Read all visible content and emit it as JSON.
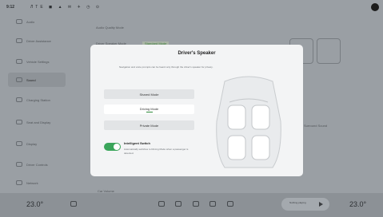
{
  "status_bar": {
    "time": "9:12",
    "icons_text": "ЛТЕ ◼ ▲ ✉ ✈ ◷ ⊙"
  },
  "sidebar": {
    "items": [
      {
        "label": "Audio",
        "active": false
      },
      {
        "label": "Driver Assistance",
        "active": false
      },
      {
        "label": "Vehicle Settings",
        "active": false
      },
      {
        "label": "Sound",
        "active": true
      },
      {
        "label": "Charging Station",
        "active": false
      },
      {
        "label": "Seat and Display",
        "active": false
      },
      {
        "label": "Display",
        "active": false
      },
      {
        "label": "Driver Controls",
        "active": false
      },
      {
        "label": "Network",
        "active": false
      }
    ]
  },
  "background": {
    "section_title": "Audio Quality Mode",
    "row_label": "Driver Speaker Mode",
    "row_tag": "Standard Mode",
    "side_label": "Surround Sound",
    "bottom_label": "Car Volume"
  },
  "modal": {
    "title": "Driver's Speaker",
    "subtitle": "Navigation and voice prompts can be heard only through the driver's speaker for privacy.",
    "modes": [
      {
        "label": "Shared Mode",
        "selected": false
      },
      {
        "label": "Driving Mode",
        "selected": true
      },
      {
        "label": "Private Mode",
        "selected": false
      }
    ],
    "smart_switch": {
      "title": "Intelligent Switch",
      "description": "Automatically switches to Driving Mode when a passenger is detected.",
      "enabled": true,
      "color": "#3aa55a"
    }
  },
  "dock": {
    "left_temp": "23.0°",
    "right_temp": "23.0°",
    "media_text": "Nothing playing"
  }
}
